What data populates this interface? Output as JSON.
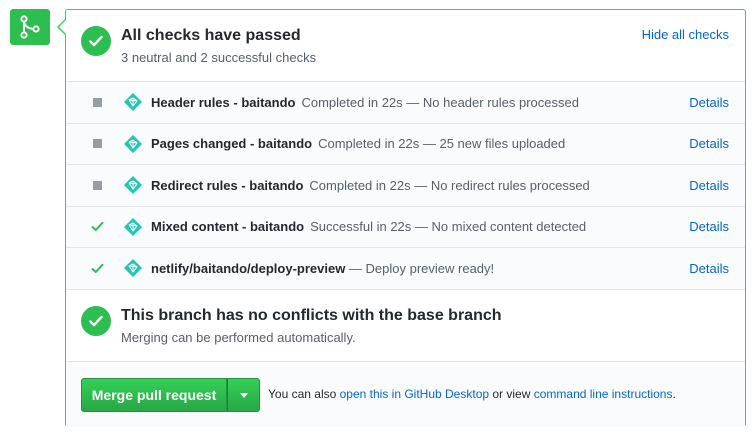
{
  "colors": {
    "success": "#2cbe4e",
    "neutral": "#959da5",
    "link": "#0366d6",
    "netlify": "#20c6b7"
  },
  "header": {
    "title": "All checks have passed",
    "subtitle": "3 neutral and 2 successful checks",
    "hide_link": "Hide all checks"
  },
  "checks": [
    {
      "status": "neutral",
      "icon": "netlify-logo-icon",
      "name": "Header rules - baitando",
      "description": "Completed in 22s — No header rules processed",
      "details": "Details"
    },
    {
      "status": "neutral",
      "icon": "netlify-logo-icon",
      "name": "Pages changed - baitando",
      "description": "Completed in 22s — 25 new files uploaded",
      "details": "Details"
    },
    {
      "status": "neutral",
      "icon": "netlify-logo-icon",
      "name": "Redirect rules - baitando",
      "description": "Completed in 22s — No redirect rules processed",
      "details": "Details"
    },
    {
      "status": "success",
      "icon": "netlify-logo-icon",
      "name": "Mixed content - baitando",
      "description": "Successful in 22s — No mixed content detected",
      "details": "Details"
    },
    {
      "status": "success",
      "icon": "netlify-logo-icon",
      "name": "netlify/baitando/deploy-preview",
      "description": " — Deploy preview ready!",
      "details": "Details"
    }
  ],
  "conflicts": {
    "title": "This branch has no conflicts with the base branch",
    "subtitle": "Merging can be performed automatically."
  },
  "merge": {
    "button_label": "Merge pull request",
    "note_prefix": "You can also ",
    "desktop_link": "open this in GitHub Desktop",
    "note_middle": " or view ",
    "cli_link": "command line instructions",
    "note_suffix": "."
  }
}
